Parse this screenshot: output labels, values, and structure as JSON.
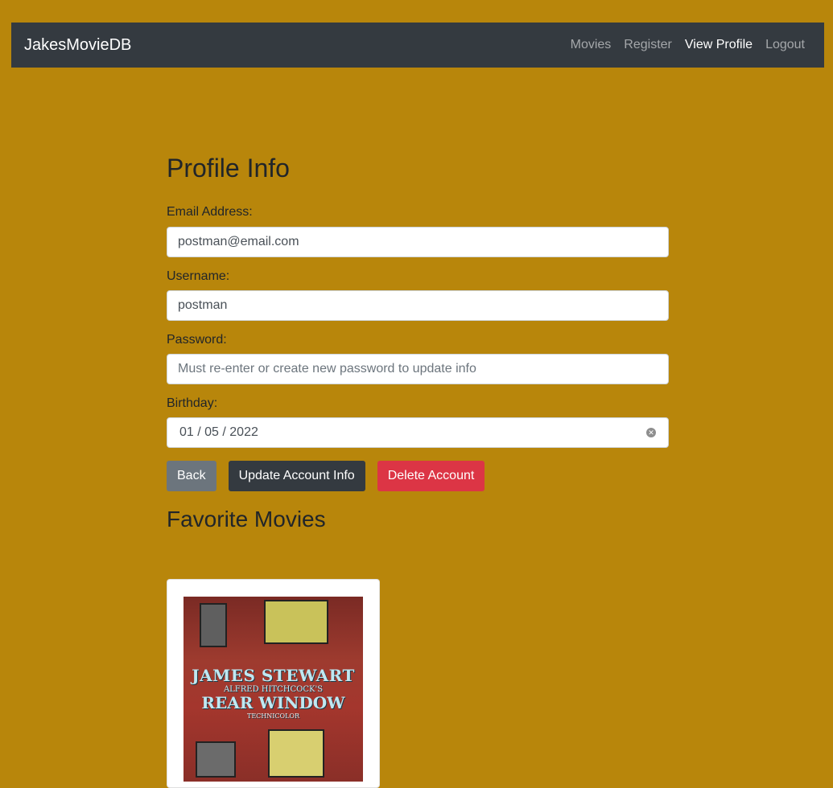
{
  "navbar": {
    "brand": "JakesMovieDB",
    "links": [
      "Movies",
      "Register",
      "View Profile",
      "Logout"
    ]
  },
  "profile": {
    "title": "Profile Info",
    "email_label": "Email Address:",
    "email_value": "postman@email.com",
    "username_label": "Username:",
    "username_value": "postman",
    "password_label": "Password:",
    "password_placeholder": "Must re-enter or create new password to update info",
    "birthday_label": "Birthday:",
    "birthday_value": "01 / 05 / 2022"
  },
  "actions": {
    "back": "Back",
    "update": "Update Account Info",
    "delete": "Delete Account"
  },
  "favorites": {
    "title": "Favorite Movies",
    "movies": [
      {
        "poster_text": [
          "JAMES STEWART",
          "ALFRED HITCHCOCK'S",
          "REAR WINDOW",
          "TECHNICOLOR"
        ]
      }
    ]
  },
  "colors": {
    "background": "#b8860b",
    "navbar": "#343a40",
    "back_button": "#6c757d",
    "update_button": "#343a40",
    "delete_button": "#dc3545"
  }
}
